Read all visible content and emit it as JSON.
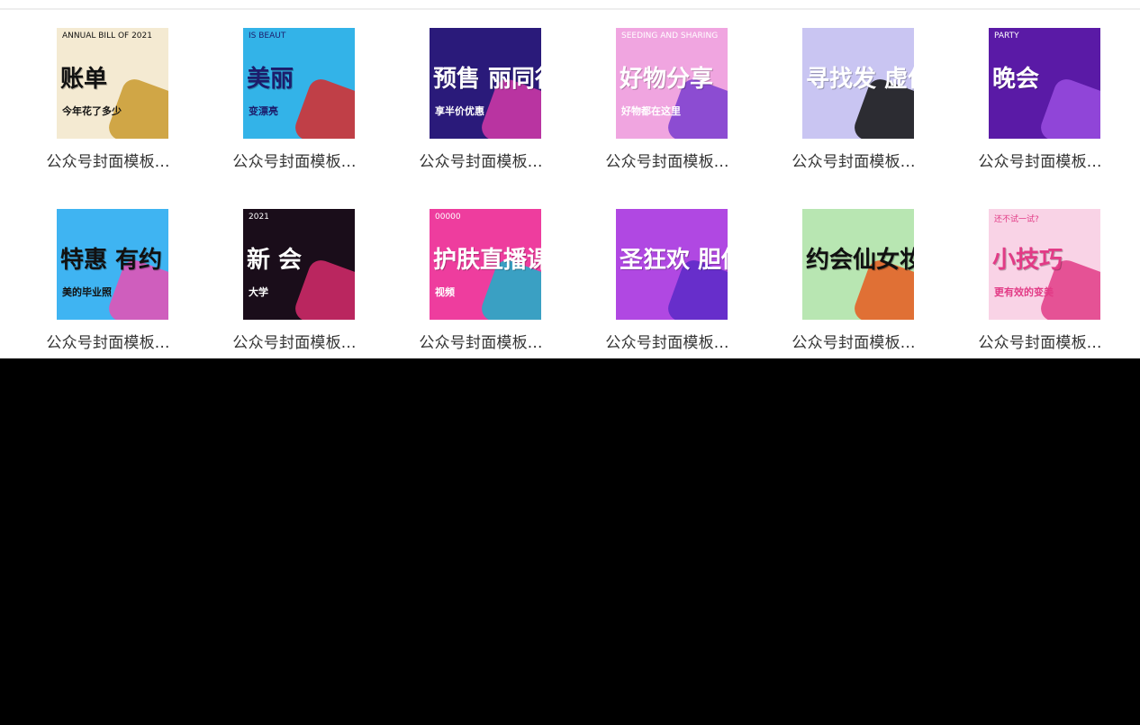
{
  "items": [
    {
      "label": "公众号封面模板...",
      "thumb_text": "账单",
      "thumb_sub": "今年花了多少",
      "thumb_top": "ANNUAL BILL OF 2021",
      "bg": "#f4ead2",
      "accent": "#c99a2e",
      "text_color": "#111111"
    },
    {
      "label": "公众号封面模板...",
      "thumb_text": "美丽",
      "thumb_sub": "变漂亮",
      "thumb_top": "IS BEAUT",
      "bg": "#33b3e8",
      "accent": "#d92a2a",
      "text_color": "#1c1c6b"
    },
    {
      "label": "公众号封面模板...",
      "thumb_text": "预售 丽同行",
      "thumb_sub": "享半价优惠",
      "thumb_top": "",
      "bg": "#2a1a7a",
      "accent": "#d23aa8",
      "text_color": "#ffffff"
    },
    {
      "label": "公众号封面模板...",
      "thumb_text": "好物分享",
      "thumb_sub": "好物都在这里",
      "thumb_top": "SEEDING AND SHARING",
      "bg": "#f0a5e0",
      "accent": "#7a3ccf",
      "text_color": "#ffffff"
    },
    {
      "label": "公众号封面模板...",
      "thumb_text": "寻找发 虚位",
      "thumb_sub": "",
      "thumb_top": "",
      "bg": "#c9c5f2",
      "accent": "#111111",
      "text_color": "#ffffff"
    },
    {
      "label": "公众号封面模板...",
      "thumb_text": "晚会",
      "thumb_sub": "",
      "thumb_top": "PARTY",
      "bg": "#5a1aa6",
      "accent": "#9a4de0",
      "text_color": "#ffffff"
    },
    {
      "label": "公众号封面模板...",
      "thumb_text": "特惠 有约",
      "thumb_sub": "美的毕业照",
      "thumb_top": "",
      "bg": "#3fb4f2",
      "accent": "#e94fb4",
      "text_color": "#111111"
    },
    {
      "label": "公众号封面模板...",
      "thumb_text": "新 会",
      "thumb_sub": "大学",
      "thumb_top": "2021",
      "bg": "#1a0d1a",
      "accent": "#d72b6c",
      "text_color": "#ffffff"
    },
    {
      "label": "公众号封面模板...",
      "thumb_text": "护肤直播课",
      "thumb_sub": "视频",
      "thumb_top": "00000",
      "bg": "#ee3d9e",
      "accent": "#1ab1c9",
      "text_color": "#ffffff"
    },
    {
      "label": "公众号封面模板...",
      "thumb_text": "圣狂欢 胆你就",
      "thumb_sub": "",
      "thumb_top": "",
      "bg": "#b048e2",
      "accent": "#5b2ac7",
      "text_color": "#ffffff"
    },
    {
      "label": "公众号封面模板...",
      "thumb_text": "约会仙女妆 必看!!",
      "thumb_sub": "",
      "thumb_top": "",
      "bg": "#b8e6b2",
      "accent": "#e65a1e",
      "text_color": "#111111"
    },
    {
      "label": "公众号封面模板...",
      "thumb_text": "小技巧",
      "thumb_sub": "更有效的变美",
      "thumb_top": "还不试一试?",
      "bg": "#f9d3e6",
      "accent": "#e23b86",
      "text_color": "#e23b86"
    }
  ]
}
